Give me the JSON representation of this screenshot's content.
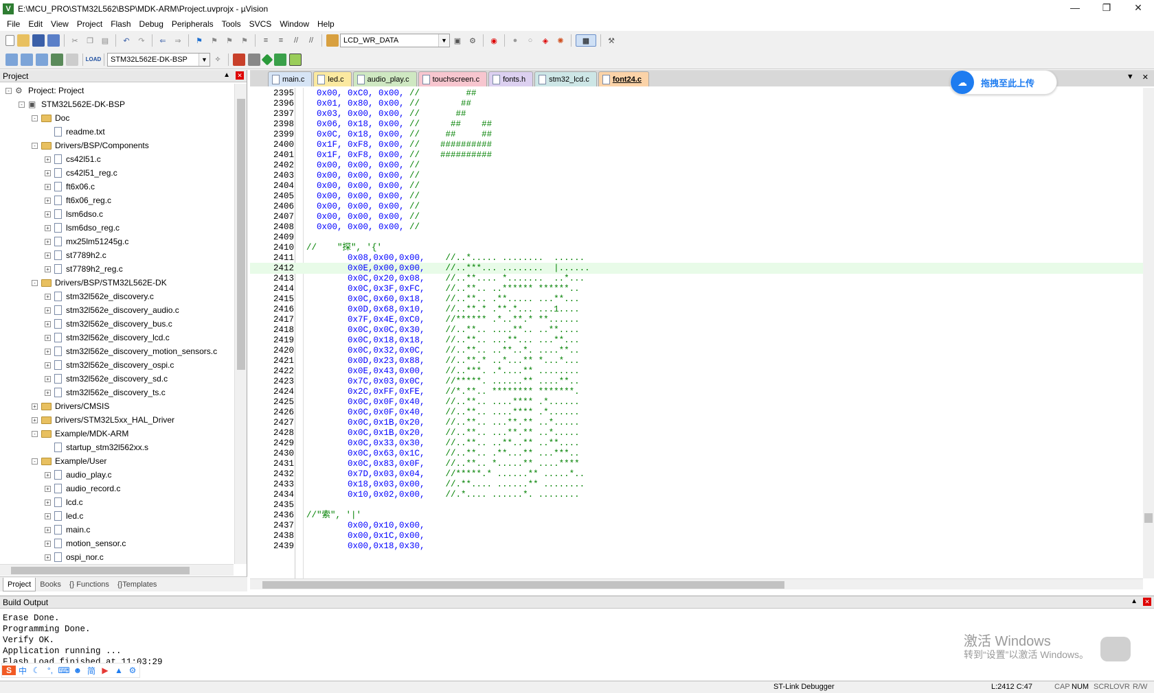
{
  "window": {
    "title": "E:\\MCU_PRO\\STM32L562\\BSP\\MDK-ARM\\Project.uvprojx - µVision"
  },
  "menu": [
    "File",
    "Edit",
    "View",
    "Project",
    "Flash",
    "Debug",
    "Peripherals",
    "Tools",
    "SVCS",
    "Window",
    "Help"
  ],
  "toolbar": {
    "find_combo": "LCD_WR_DATA",
    "target_combo": "STM32L562E-DK-BSP"
  },
  "project_panel": {
    "title": "Project",
    "tabs": [
      "Project",
      "Books",
      "Functions",
      "Templates"
    ],
    "tree": [
      {
        "label": "Project: Project",
        "level": 0,
        "kind": "project",
        "exp": "-"
      },
      {
        "label": "STM32L562E-DK-BSP",
        "level": 1,
        "kind": "target",
        "exp": "-"
      },
      {
        "label": "Doc",
        "level": 2,
        "kind": "folder",
        "exp": "-"
      },
      {
        "label": "readme.txt",
        "level": 3,
        "kind": "file",
        "exp": ""
      },
      {
        "label": "Drivers/BSP/Components",
        "level": 2,
        "kind": "folder",
        "exp": "-"
      },
      {
        "label": "cs42l51.c",
        "level": 3,
        "kind": "file",
        "exp": "+"
      },
      {
        "label": "cs42l51_reg.c",
        "level": 3,
        "kind": "file",
        "exp": "+"
      },
      {
        "label": "ft6x06.c",
        "level": 3,
        "kind": "file",
        "exp": "+"
      },
      {
        "label": "ft6x06_reg.c",
        "level": 3,
        "kind": "file",
        "exp": "+"
      },
      {
        "label": "lsm6dso.c",
        "level": 3,
        "kind": "file",
        "exp": "+"
      },
      {
        "label": "lsm6dso_reg.c",
        "level": 3,
        "kind": "file",
        "exp": "+"
      },
      {
        "label": "mx25lm51245g.c",
        "level": 3,
        "kind": "file",
        "exp": "+"
      },
      {
        "label": "st7789h2.c",
        "level": 3,
        "kind": "file",
        "exp": "+"
      },
      {
        "label": "st7789h2_reg.c",
        "level": 3,
        "kind": "file",
        "exp": "+"
      },
      {
        "label": "Drivers/BSP/STM32L562E-DK",
        "level": 2,
        "kind": "folder",
        "exp": "-"
      },
      {
        "label": "stm32l562e_discovery.c",
        "level": 3,
        "kind": "file",
        "exp": "+"
      },
      {
        "label": "stm32l562e_discovery_audio.c",
        "level": 3,
        "kind": "file",
        "exp": "+"
      },
      {
        "label": "stm32l562e_discovery_bus.c",
        "level": 3,
        "kind": "file",
        "exp": "+"
      },
      {
        "label": "stm32l562e_discovery_lcd.c",
        "level": 3,
        "kind": "file",
        "exp": "+"
      },
      {
        "label": "stm32l562e_discovery_motion_sensors.c",
        "level": 3,
        "kind": "file",
        "exp": "+"
      },
      {
        "label": "stm32l562e_discovery_ospi.c",
        "level": 3,
        "kind": "file",
        "exp": "+"
      },
      {
        "label": "stm32l562e_discovery_sd.c",
        "level": 3,
        "kind": "file",
        "exp": "+"
      },
      {
        "label": "stm32l562e_discovery_ts.c",
        "level": 3,
        "kind": "file",
        "exp": "+"
      },
      {
        "label": "Drivers/CMSIS",
        "level": 2,
        "kind": "folder",
        "exp": "+"
      },
      {
        "label": "Drivers/STM32L5xx_HAL_Driver",
        "level": 2,
        "kind": "folder",
        "exp": "+"
      },
      {
        "label": "Example/MDK-ARM",
        "level": 2,
        "kind": "folder",
        "exp": "-"
      },
      {
        "label": "startup_stm32l562xx.s",
        "level": 3,
        "kind": "file",
        "exp": ""
      },
      {
        "label": "Example/User",
        "level": 2,
        "kind": "folder",
        "exp": "-"
      },
      {
        "label": "audio_play.c",
        "level": 3,
        "kind": "file",
        "exp": "+"
      },
      {
        "label": "audio_record.c",
        "level": 3,
        "kind": "file",
        "exp": "+"
      },
      {
        "label": "lcd.c",
        "level": 3,
        "kind": "file",
        "exp": "+"
      },
      {
        "label": "led.c",
        "level": 3,
        "kind": "file",
        "exp": "+"
      },
      {
        "label": "main.c",
        "level": 3,
        "kind": "file",
        "exp": "+"
      },
      {
        "label": "motion_sensor.c",
        "level": 3,
        "kind": "file",
        "exp": "+"
      },
      {
        "label": "ospi_nor.c",
        "level": 3,
        "kind": "file",
        "exp": "+"
      }
    ]
  },
  "editor": {
    "tabs": [
      {
        "label": "main.c",
        "color": "#d6e4f5"
      },
      {
        "label": "led.c",
        "color": "#fbe9a0"
      },
      {
        "label": "audio_play.c",
        "color": "#cfe8c2"
      },
      {
        "label": "touchscreen.c",
        "color": "#f7c6cf"
      },
      {
        "label": "fonts.h",
        "color": "#dcd0f0"
      },
      {
        "label": "stm32_lcd.c",
        "color": "#cde6e6"
      },
      {
        "label": "font24.c",
        "color": "#fbd3a8"
      }
    ],
    "active_tab": "font24.c",
    "highlight_line": "2412",
    "lines": [
      {
        "n": "2395",
        "code": "0x00, 0xC0, 0x00, ",
        "comment": "//         ##"
      },
      {
        "n": "2396",
        "code": "0x01, 0x80, 0x00, ",
        "comment": "//        ##"
      },
      {
        "n": "2397",
        "code": "0x03, 0x00, 0x00, ",
        "comment": "//       ##"
      },
      {
        "n": "2398",
        "code": "0x06, 0x18, 0x00, ",
        "comment": "//      ##    ##"
      },
      {
        "n": "2399",
        "code": "0x0C, 0x18, 0x00, ",
        "comment": "//     ##     ##"
      },
      {
        "n": "2400",
        "code": "0x1F, 0xF8, 0x00, ",
        "comment": "//    ##########"
      },
      {
        "n": "2401",
        "code": "0x1F, 0xF8, 0x00, ",
        "comment": "//    ##########"
      },
      {
        "n": "2402",
        "code": "0x00, 0x00, 0x00, ",
        "comment": "//"
      },
      {
        "n": "2403",
        "code": "0x00, 0x00, 0x00, ",
        "comment": "//"
      },
      {
        "n": "2404",
        "code": "0x00, 0x00, 0x00, ",
        "comment": "//"
      },
      {
        "n": "2405",
        "code": "0x00, 0x00, 0x00, ",
        "comment": "//"
      },
      {
        "n": "2406",
        "code": "0x00, 0x00, 0x00, ",
        "comment": "//"
      },
      {
        "n": "2407",
        "code": "0x00, 0x00, 0x00, ",
        "comment": "//"
      },
      {
        "n": "2408",
        "code": "0x00, 0x00, 0x00, ",
        "comment": "//"
      },
      {
        "n": "2409",
        "code": "",
        "comment": ""
      },
      {
        "n": "2410",
        "code": "",
        "comment": "//    \"探\", '{'"
      },
      {
        "n": "2411",
        "code": "      0x08,0x00,0x00,    ",
        "comment": "//..*..... ........  ......"
      },
      {
        "n": "2412",
        "code": "      0x0E,0x00,0x00,    ",
        "comment": "//..***... ........  |......"
      },
      {
        "n": "2413",
        "code": "      0x0C,0x20,0x08,    ",
        "comment": "//..**.... *.......  ..*..."
      },
      {
        "n": "2414",
        "code": "      0x0C,0x3F,0xFC,    ",
        "comment": "//..**.. ..****** ******.."
      },
      {
        "n": "2415",
        "code": "      0x0C,0x60,0x18,    ",
        "comment": "//..**.. .**..... ...**..."
      },
      {
        "n": "2416",
        "code": "      0x0D,0x68,0x10,    ",
        "comment": "//..**.* .**.*... ...1...."
      },
      {
        "n": "2417",
        "code": "      0x7F,0x4E,0xC0,    ",
        "comment": "//****** .*..**.* **......"
      },
      {
        "n": "2418",
        "code": "      0x0C,0x0C,0x30,    ",
        "comment": "//..**.. ....**.. ..**...."
      },
      {
        "n": "2419",
        "code": "      0x0C,0x18,0x18,    ",
        "comment": "//..**.. ...**... ...**..."
      },
      {
        "n": "2420",
        "code": "      0x0C,0x32,0x0C,    ",
        "comment": "//..**.. ..**..*. ....**.."
      },
      {
        "n": "2421",
        "code": "      0x0D,0x23,0x88,    ",
        "comment": "//..**.* ..*...** *...*..."
      },
      {
        "n": "2422",
        "code": "      0x0E,0x43,0x00,    ",
        "comment": "//..***. .*....** ........"
      },
      {
        "n": "2423",
        "code": "      0x7C,0x03,0x0C,    ",
        "comment": "//*****. ......** ....**.."
      },
      {
        "n": "2424",
        "code": "      0x2C,0xFF,0xFE,    ",
        "comment": "//*.**.. ******** *******."
      },
      {
        "n": "2425",
        "code": "      0x0C,0x0F,0x40,    ",
        "comment": "//..**.. ....**** .*......"
      },
      {
        "n": "2426",
        "code": "      0x0C,0x0F,0x40,    ",
        "comment": "//..**.. ....**** .*......"
      },
      {
        "n": "2427",
        "code": "      0x0C,0x1B,0x20,    ",
        "comment": "//..**.. ...**.** ..*....."
      },
      {
        "n": "2428",
        "code": "      0x0C,0x1B,0x20,    ",
        "comment": "//..**.. ...**.** ..*....."
      },
      {
        "n": "2429",
        "code": "      0x0C,0x33,0x30,    ",
        "comment": "//..**.. ..**..** ..**...."
      },
      {
        "n": "2430",
        "code": "      0x0C,0x63,0x1C,    ",
        "comment": "//..**.. .**...** ...***.."
      },
      {
        "n": "2431",
        "code": "      0x0C,0x83,0x0F,    ",
        "comment": "//..**.. *.....** ....****"
      },
      {
        "n": "2432",
        "code": "      0x7D,0x03,0x04,    ",
        "comment": "//*****.* ......** .....*.."
      },
      {
        "n": "2433",
        "code": "      0x18,0x03,0x00,    ",
        "comment": "//.**.... ......** ........"
      },
      {
        "n": "2434",
        "code": "      0x10,0x02,0x00,    ",
        "comment": "//.*.... ......*. ........"
      },
      {
        "n": "2435",
        "code": "",
        "comment": ""
      },
      {
        "n": "2436",
        "code": "",
        "comment": "//\"索\", '|'"
      },
      {
        "n": "2437",
        "code": "      0x00,0x10,0x00,",
        "comment": ""
      },
      {
        "n": "2438",
        "code": "      0x00,0x1C,0x00,",
        "comment": ""
      },
      {
        "n": "2439",
        "code": "      0x00,0x18,0x30,",
        "comment": ""
      }
    ]
  },
  "upload_widget": {
    "label": "拖拽至此上传"
  },
  "build_output": {
    "title": "Build Output",
    "lines": [
      "Erase Done.",
      "Programming Done.",
      "Verify OK.",
      "Application running ...",
      "Flash Load finished at 11:03:29"
    ]
  },
  "activation": {
    "line1": "激活 Windows",
    "line2": "转到“设置”以激活 Windows。"
  },
  "ime": [
    "中",
    "简"
  ],
  "status": {
    "debugger": "ST-Link Debugger",
    "position": "L:2412 C:47",
    "caps": "CAP",
    "num": "NUM",
    "scrl": "SCRL",
    "ovr": "OVR",
    "rw": "R/W"
  }
}
